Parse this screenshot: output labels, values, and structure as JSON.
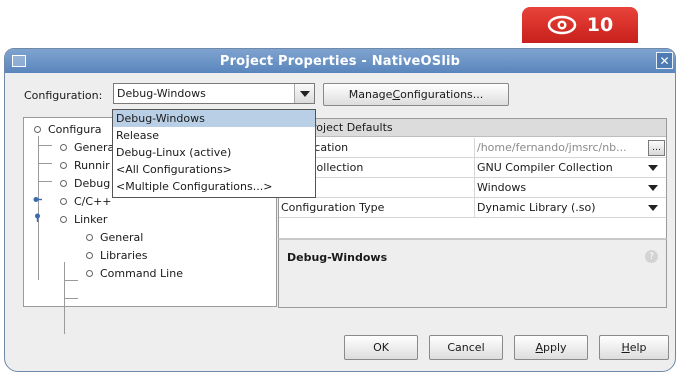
{
  "badge": {
    "icon": "eye-icon",
    "number": "10",
    "color": "#d62b22"
  },
  "window": {
    "title": "Project Properties - NativeOSlib",
    "close_glyph": "✕"
  },
  "configuration": {
    "label": "Configuration:",
    "selected": "Debug-Windows",
    "manage_button": {
      "pre": "Manage ",
      "mnemonic": "C",
      "post": "onfigurations..."
    },
    "dropdown_options": [
      "Debug-Windows",
      "Release",
      "Debug-Linux (active)",
      "<All Configurations>",
      "<Multiple Configurations...>"
    ]
  },
  "tree": {
    "items": [
      {
        "label": "Configura",
        "level": 0
      },
      {
        "label": "Genera",
        "level": 1
      },
      {
        "label": "Runnir",
        "level": 1
      },
      {
        "label": "Debug",
        "level": 1
      },
      {
        "label": "C/C++",
        "level": 1
      },
      {
        "label": "Linker",
        "level": 1
      },
      {
        "label": "General",
        "level": 2
      },
      {
        "label": "Libraries",
        "level": 2
      },
      {
        "label": "Command Line",
        "level": 2
      }
    ]
  },
  "properties": {
    "header": "roject Defaults",
    "rows": [
      {
        "name": "ect Location",
        "value": "/home/fernando/jmsrc/nb...",
        "control": "ellipsis"
      },
      {
        "name": "piler Collection",
        "value": "GNU Compiler Collection",
        "control": "dropdown"
      },
      {
        "name": "form",
        "value": "Windows",
        "control": "dropdown"
      },
      {
        "name": "Configuration Type",
        "value": "Dynamic Library (.so)",
        "control": "dropdown"
      }
    ]
  },
  "description": {
    "title": "Debug-Windows",
    "help_glyph": "?"
  },
  "buttons": {
    "ok": "OK",
    "cancel": "Cancel",
    "apply": {
      "mnemonic": "A",
      "post": "pply"
    },
    "help": {
      "mnemonic": "H",
      "post": "elp"
    }
  }
}
